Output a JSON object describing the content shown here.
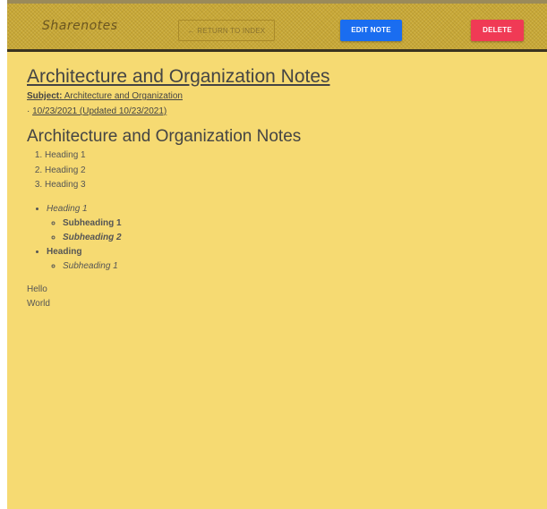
{
  "navbar": {
    "brand": "Sharenotes",
    "return_label": "← RETURN TO INDEX",
    "edit_label": "EDIT NOTE",
    "delete_label": "DELETE"
  },
  "note": {
    "title": "Architecture and Organization Notes",
    "subject_label": "Subject:",
    "subject_value": "Architecture and Organization",
    "date_prefix": "· ",
    "date": "10/23/2021 (Updated 10/23/2021)",
    "heading": "Architecture and Organization Notes",
    "ordered": [
      "Heading 1",
      "Heading 2",
      "Heading 3"
    ],
    "bullets": {
      "b1": "Heading 1",
      "b1_sub1": "Subheading 1",
      "b1_sub2": "Subheading 2",
      "b2": "Heading",
      "b2_sub1": "Subheading 1"
    },
    "para_lines": [
      "Hello",
      "World"
    ]
  },
  "colors": {
    "page_bg": "#f6da72",
    "edit_button": "#1a6df0",
    "delete_button": "#f03a55"
  }
}
